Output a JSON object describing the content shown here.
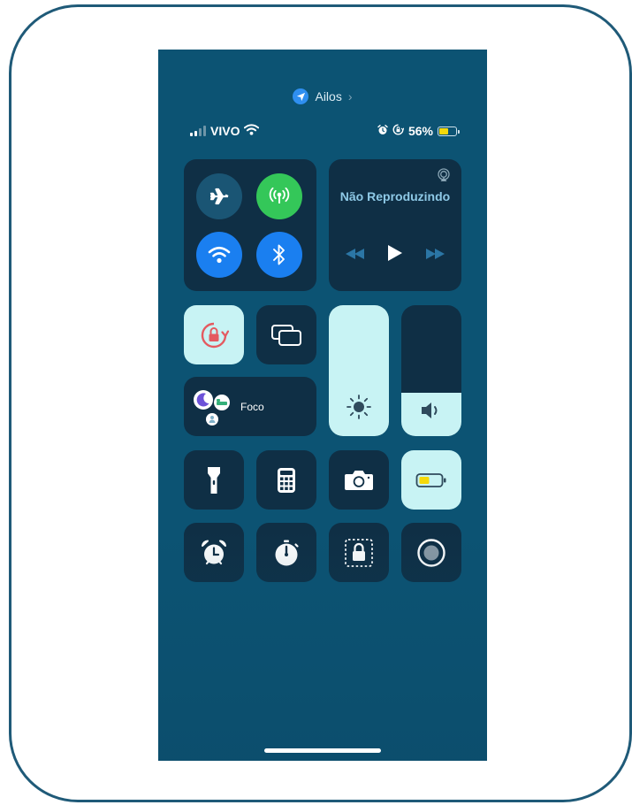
{
  "location": {
    "label": "Ailos",
    "icon": "location-arrow-icon"
  },
  "status_bar": {
    "carrier": "VIVO",
    "battery_percent": "56%",
    "battery_level": 0.56,
    "icons": [
      "signal-bars-icon",
      "wifi-icon",
      "alarm-icon",
      "orientation-lock-icon",
      "battery-icon"
    ]
  },
  "connectivity": {
    "airplane": {
      "on": false,
      "icon": "airplane-icon"
    },
    "cellular": {
      "on": true,
      "icon": "cellular-antenna-icon"
    },
    "wifi": {
      "on": true,
      "icon": "wifi-icon"
    },
    "bluetooth": {
      "on": true,
      "icon": "bluetooth-icon"
    }
  },
  "media": {
    "title": "Não Reproduzindo",
    "icons": [
      "airplay-icon",
      "rewind-icon",
      "play-icon",
      "fast-forward-icon"
    ]
  },
  "toggles": {
    "orientation_lock": {
      "on": true,
      "icon": "rotation-lock-icon"
    },
    "screen_mirroring": {
      "on": false,
      "icon": "screen-mirroring-icon"
    }
  },
  "focus": {
    "label": "Foco",
    "icons": [
      "moon-icon",
      "bed-icon",
      "person-icon"
    ]
  },
  "sliders": {
    "brightness": {
      "level": 1.0,
      "icon": "sun-icon"
    },
    "volume": {
      "level": 0.33,
      "icon": "speaker-icon"
    }
  },
  "shortcuts": [
    {
      "name": "flashlight",
      "icon": "flashlight-icon",
      "on": false
    },
    {
      "name": "calculator",
      "icon": "calculator-icon",
      "on": false
    },
    {
      "name": "camera",
      "icon": "camera-icon",
      "on": false
    },
    {
      "name": "low-power-mode",
      "icon": "low-battery-icon",
      "on": true
    },
    {
      "name": "alarm",
      "icon": "alarm-clock-icon",
      "on": false
    },
    {
      "name": "timer",
      "icon": "timer-icon",
      "on": false
    },
    {
      "name": "guided-access",
      "icon": "guided-access-lock-icon",
      "on": false
    },
    {
      "name": "screen-recording",
      "icon": "screen-record-icon",
      "on": false
    }
  ],
  "colors": {
    "background": "#0c5373",
    "tile": "#0f2f45",
    "tile_active_light": "#c8f3f4",
    "active_blue": "#1a7ff0",
    "active_green": "#34c759",
    "battery_yellow": "#f5d90a",
    "frame": "#1f5a78"
  }
}
